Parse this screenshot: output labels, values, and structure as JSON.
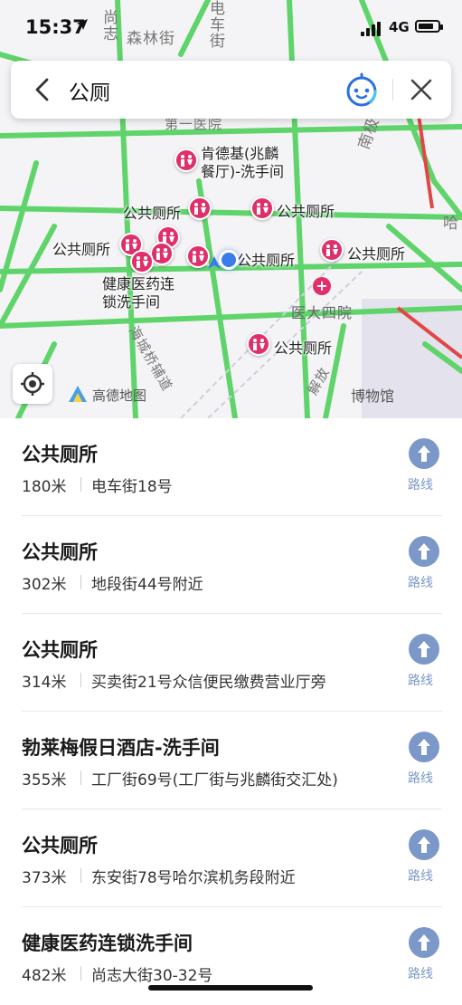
{
  "status_bar": {
    "time": "15:37",
    "network": "4G"
  },
  "search": {
    "query": "公厕"
  },
  "map": {
    "street_labels": {
      "senlin": "森林街",
      "shangzhi": "尚志",
      "dianche": "电车街",
      "nanjiao": "南极",
      "haha": "哈",
      "hospital1": "第一医院",
      "haicheng": "海城桥辅道",
      "yida": "医大四院",
      "bowuguan": "博物馆",
      "jiefang": "解放"
    },
    "pois": [
      {
        "label": "肯德基(兆麟\n餐厅)-洗手间"
      },
      {
        "label": "公共厕所"
      },
      {
        "label": "公共厕所"
      },
      {
        "label": "公共厕所"
      },
      {
        "label": "公共厕所"
      },
      {
        "label": "公共厕所"
      },
      {
        "label": "健康医药连\n锁洗手间"
      }
    ],
    "logo": "高德地图",
    "colors": {
      "road_green": "#5fd46a",
      "road_red": "#e04848",
      "marker": "#e0306b",
      "user_dot": "#3c7bea"
    }
  },
  "results": [
    {
      "title": "公共厕所",
      "distance": "180米",
      "address": "电车街18号",
      "route_label": "路线"
    },
    {
      "title": "公共厕所",
      "distance": "302米",
      "address": "地段街44号附近",
      "route_label": "路线"
    },
    {
      "title": "公共厕所",
      "distance": "314米",
      "address": "买卖街21号众信便民缴费营业厅旁",
      "route_label": "路线"
    },
    {
      "title": "勃莱梅假日酒店-洗手间",
      "distance": "355米",
      "address": "工厂街69号(工厂街与兆麟街交汇处)",
      "route_label": "路线"
    },
    {
      "title": "公共厕所",
      "distance": "373米",
      "address": "东安街78号哈尔滨机务段附近",
      "route_label": "路线"
    },
    {
      "title": "健康医药连锁洗手间",
      "distance": "482米",
      "address": "尚志大街30-32号",
      "route_label": "路线"
    }
  ]
}
